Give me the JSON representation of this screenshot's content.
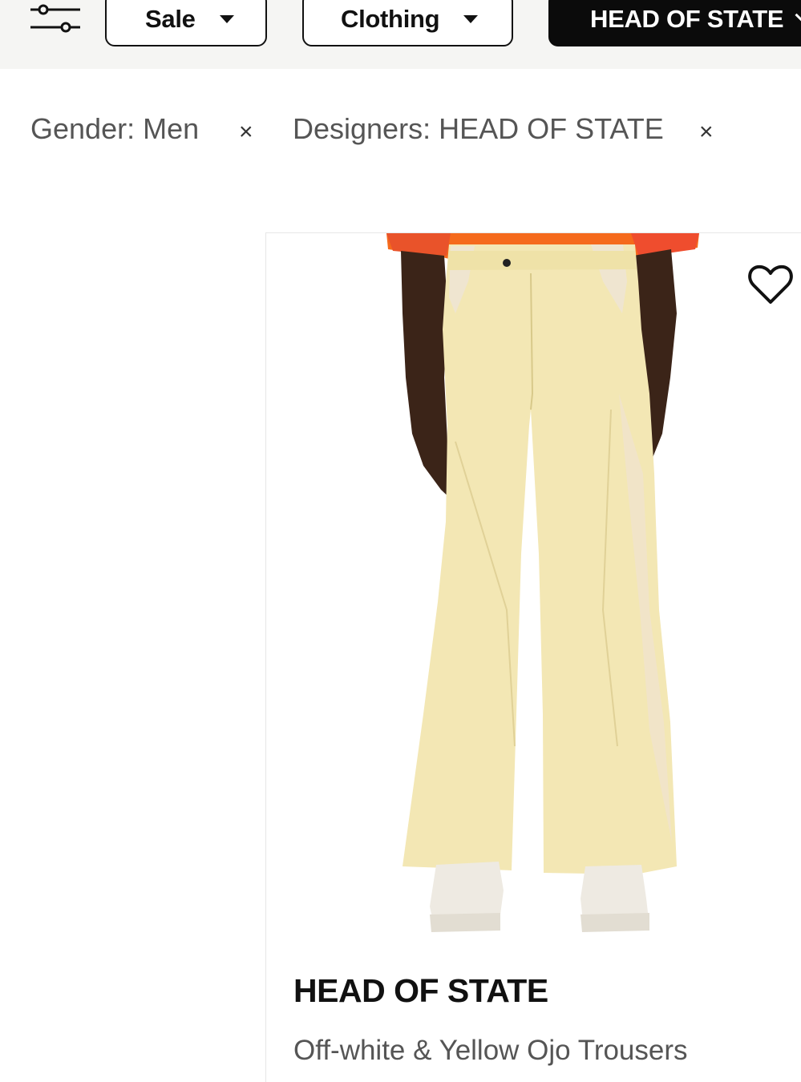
{
  "filters_bar": {
    "sale_label": "Sale",
    "clothing_label": "Clothing",
    "designer_label": "HEAD OF STATE"
  },
  "active_filters": [
    {
      "label": "Gender: Men",
      "remove": "×"
    },
    {
      "label": "Designers: HEAD OF STATE",
      "remove": "×"
    }
  ],
  "product": {
    "brand": "HEAD OF STATE",
    "name": "Off-white & Yellow Ojo Trousers",
    "image_icon": "trousers-photo",
    "wishlist_icon": "heart-icon"
  },
  "colors": {
    "chip_active_bg": "#0b0b0b",
    "trouser_yellow": "#f3e7b4",
    "shirt_orange": "#f56a1c"
  }
}
